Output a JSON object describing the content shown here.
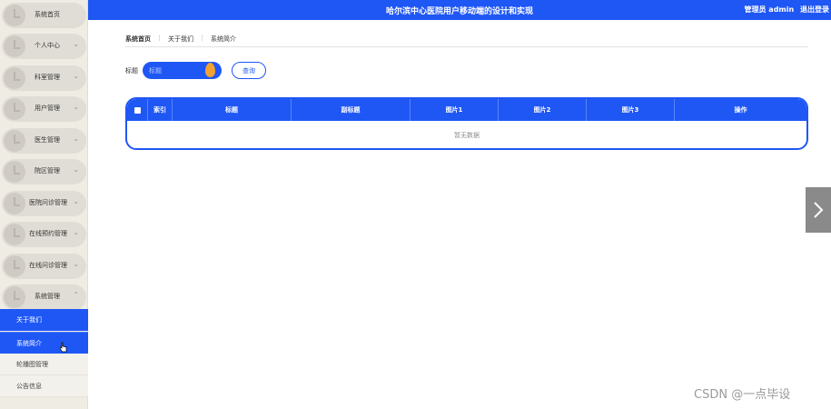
{
  "header": {
    "title": "哈尔滨中心医院用户移动端的设计和实现",
    "user_text": "管理员 admin",
    "logout_label": "退出登录"
  },
  "sidebar": {
    "items": [
      {
        "label": "系统首页",
        "has_chevron": false
      },
      {
        "label": "个人中心",
        "has_chevron": true
      },
      {
        "label": "科室管理",
        "has_chevron": true
      },
      {
        "label": "用户管理",
        "has_chevron": true
      },
      {
        "label": "医生管理",
        "has_chevron": true
      },
      {
        "label": "院区管理",
        "has_chevron": true
      },
      {
        "label": "医院问诊管理",
        "has_chevron": true
      },
      {
        "label": "在线预约管理",
        "has_chevron": true
      },
      {
        "label": "在线问诊管理",
        "has_chevron": true
      },
      {
        "label": "系统管理",
        "has_chevron": true,
        "expanded": true
      }
    ],
    "sub_items": [
      {
        "label": "关于我们",
        "active": true
      },
      {
        "label": "系统简介",
        "active": true
      },
      {
        "label": "轮播图管理",
        "active": false
      },
      {
        "label": "公告信息",
        "active": false
      }
    ]
  },
  "breadcrumb": [
    "系统首页",
    "关于我们",
    "系统简介"
  ],
  "search": {
    "label": "标题",
    "placeholder": "标题",
    "button_label": "查询"
  },
  "table": {
    "columns": [
      "索引",
      "标题",
      "副标题",
      "图片1",
      "图片2",
      "图片3",
      "操作"
    ],
    "empty_text": "暂无数据"
  },
  "watermark": "CSDN @一点毕设",
  "colors": {
    "primary": "#1f57f5",
    "sidebar_bg": "#efece4",
    "accent_orange": "#f2a133"
  }
}
